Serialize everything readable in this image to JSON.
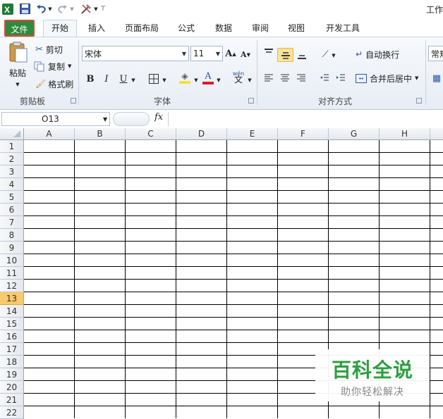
{
  "window": {
    "title": "工作"
  },
  "ribbon_tabs": [
    "文件",
    "开始",
    "插入",
    "页面布局",
    "公式",
    "数据",
    "审阅",
    "视图",
    "开发工具"
  ],
  "clipboard": {
    "paste": "粘贴",
    "cut": "剪切",
    "copy": "复制",
    "format_painter": "格式刷",
    "label": "剪贴板"
  },
  "font": {
    "name": "宋体",
    "size": "11",
    "label": "字体",
    "underline_color": "#e02020",
    "highlight_color": "#f7e13a"
  },
  "alignment": {
    "wrap_text": "自动换行",
    "merge_center": "合并后居中",
    "label": "对齐方式"
  },
  "number": {
    "format": "常规"
  },
  "formula_bar": {
    "name_box": "O13",
    "fx": "fx",
    "value": ""
  },
  "sheet": {
    "columns": [
      "A",
      "B",
      "C",
      "D",
      "E",
      "F",
      "G",
      "H"
    ],
    "rows": [
      "1",
      "2",
      "3",
      "4",
      "5",
      "6",
      "7",
      "8",
      "9",
      "10",
      "11",
      "12",
      "13",
      "14",
      "15",
      "16",
      "17",
      "18",
      "19",
      "20",
      "21",
      "22"
    ],
    "active_row": "13"
  },
  "watermark": {
    "title": "百科全说",
    "subtitle": "助你轻松解决",
    "color": "#2c9f3e"
  },
  "colors": {
    "file_tab": "#2f8a3c",
    "file_tab_border": "#e0473d",
    "active_row": "#f9c96a",
    "selected_align": "#fde49a"
  }
}
